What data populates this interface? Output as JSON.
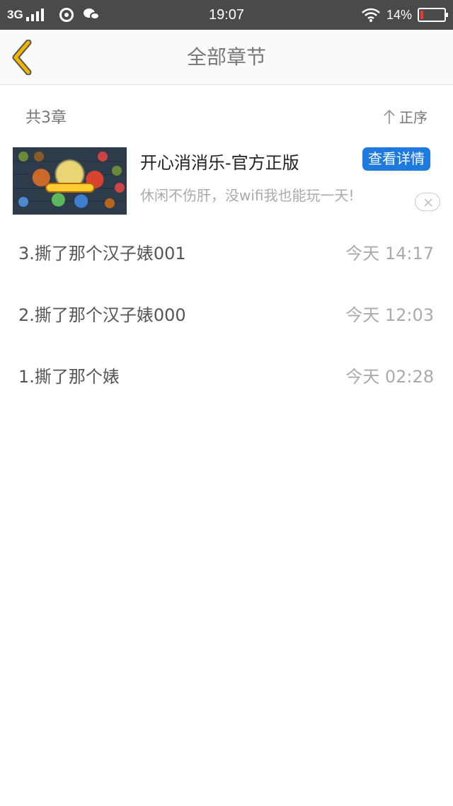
{
  "status_bar": {
    "network": "3G",
    "time": "19:07",
    "battery_percent": "14%",
    "battery_level": 0.14,
    "icons": [
      "signal-icon",
      "netease-music-icon",
      "wechat-icon",
      "wifi-icon",
      "battery-icon"
    ]
  },
  "header": {
    "title": "全部章节",
    "back_icon": "chevron-left-icon",
    "accent_color": "#f0b400"
  },
  "summary": {
    "count_label": "共3章",
    "sort_label": "正序",
    "sort_icon": "arrow-up-icon"
  },
  "ad": {
    "title": "开心消消乐-官方正版",
    "description": "休闲不伤肝，没wifi我也能玩一天!",
    "button_label": "查看详情",
    "button_color": "#1f7ae0",
    "close_icon": "close-icon"
  },
  "chapters": [
    {
      "title": "3.撕了那个汉子婊001",
      "time": "今天  14:17"
    },
    {
      "title": "2.撕了那个汉子婊000",
      "time": "今天  12:03"
    },
    {
      "title": "1.撕了那个婊",
      "time": "今天  02:28"
    }
  ]
}
